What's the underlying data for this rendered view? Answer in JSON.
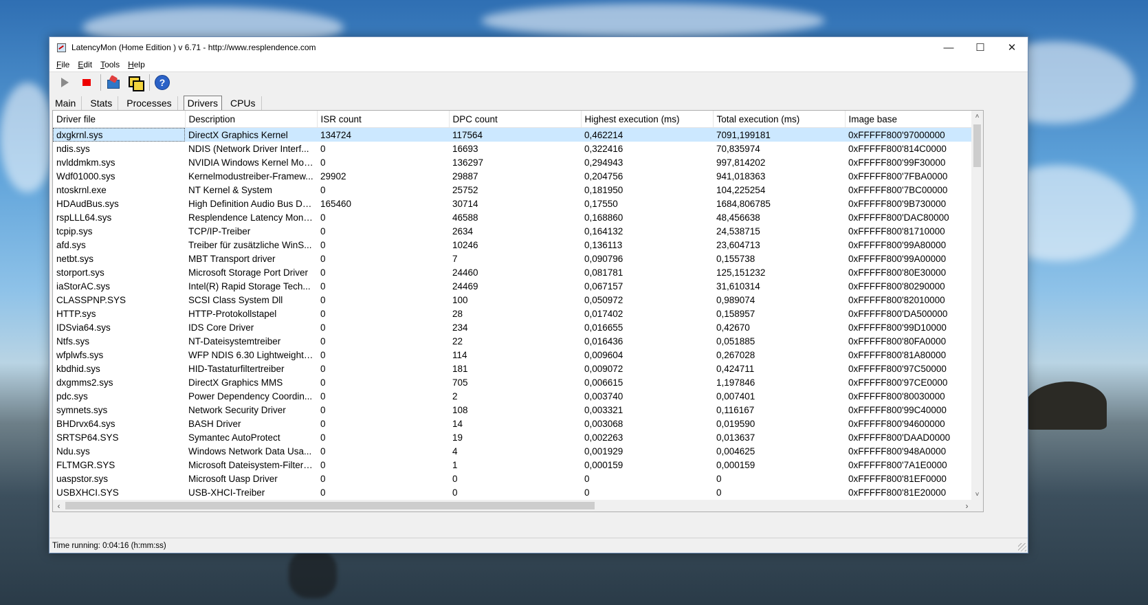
{
  "window": {
    "title": "LatencyMon  (Home Edition )  v 6.71 - http://www.resplendence.com",
    "minimize": "—",
    "maximize": "☐",
    "close": "✕"
  },
  "menu": [
    {
      "label": "File",
      "accel": "F",
      "rest": "ile"
    },
    {
      "label": "Edit",
      "accel": "E",
      "rest": "dit"
    },
    {
      "label": "Tools",
      "accel": "T",
      "rest": "ools"
    },
    {
      "label": "Help",
      "accel": "H",
      "rest": "elp"
    }
  ],
  "toolbar": {
    "icons": [
      "play-icon",
      "stop-icon",
      "monitor-icon",
      "copy-icon",
      "help-icon"
    ],
    "help_glyph": "?"
  },
  "tabs": [
    "Main",
    "Stats",
    "Processes",
    "Drivers",
    "CPUs"
  ],
  "active_tab": "Drivers",
  "table": {
    "columns": [
      "Driver file",
      "Description",
      "ISR count",
      "DPC count",
      "Highest execution (ms)",
      "Total execution (ms)",
      "Image base"
    ],
    "rows": [
      [
        "dxgkrnl.sys",
        "DirectX Graphics Kernel",
        "134724",
        "117564",
        "0,462214",
        "7091,199181",
        "0xFFFFF800'97000000"
      ],
      [
        "ndis.sys",
        "NDIS (Network Driver Interf...",
        "0",
        "16693",
        "0,322416",
        "70,835974",
        "0xFFFFF800'814C0000"
      ],
      [
        "nvlddmkm.sys",
        "NVIDIA Windows Kernel Mod...",
        "0",
        "136297",
        "0,294943",
        "997,814202",
        "0xFFFFF800'99F30000"
      ],
      [
        "Wdf01000.sys",
        "Kernelmodustreiber-Framew...",
        "29902",
        "29887",
        "0,204756",
        "941,018363",
        "0xFFFFF800'7FBA0000"
      ],
      [
        "ntoskrnl.exe",
        "NT Kernel & System",
        "0",
        "25752",
        "0,181950",
        "104,225254",
        "0xFFFFF800'7BC00000"
      ],
      [
        "HDAudBus.sys",
        "High Definition Audio Bus Dri...",
        "165460",
        "30714",
        "0,17550",
        "1684,806785",
        "0xFFFFF800'9B730000"
      ],
      [
        "rspLLL64.sys",
        "Resplendence Latency Monit...",
        "0",
        "46588",
        "0,168860",
        "48,456638",
        "0xFFFFF800'DAC80000"
      ],
      [
        "tcpip.sys",
        "TCP/IP-Treiber",
        "0",
        "2634",
        "0,164132",
        "24,538715",
        "0xFFFFF800'81710000"
      ],
      [
        "afd.sys",
        "Treiber für zusätzliche WinS...",
        "0",
        "10246",
        "0,136113",
        "23,604713",
        "0xFFFFF800'99A80000"
      ],
      [
        "netbt.sys",
        "MBT Transport driver",
        "0",
        "7",
        "0,090796",
        "0,155738",
        "0xFFFFF800'99A00000"
      ],
      [
        "storport.sys",
        "Microsoft Storage Port Driver",
        "0",
        "24460",
        "0,081781",
        "125,151232",
        "0xFFFFF800'80E30000"
      ],
      [
        "iaStorAC.sys",
        "Intel(R) Rapid Storage Tech...",
        "0",
        "24469",
        "0,067157",
        "31,610314",
        "0xFFFFF800'80290000"
      ],
      [
        "CLASSPNP.SYS",
        "SCSI Class System Dll",
        "0",
        "100",
        "0,050972",
        "0,989074",
        "0xFFFFF800'82010000"
      ],
      [
        "HTTP.sys",
        "HTTP-Protokollstapel",
        "0",
        "28",
        "0,017402",
        "0,158957",
        "0xFFFFF800'DA500000"
      ],
      [
        "IDSvia64.sys",
        "IDS Core Driver",
        "0",
        "234",
        "0,016655",
        "0,42670",
        "0xFFFFF800'99D10000"
      ],
      [
        "Ntfs.sys",
        "NT-Dateisystemtreiber",
        "0",
        "22",
        "0,016436",
        "0,051885",
        "0xFFFFF800'80FA0000"
      ],
      [
        "wfplwfs.sys",
        "WFP NDIS 6.30 Lightweight ...",
        "0",
        "114",
        "0,009604",
        "0,267028",
        "0xFFFFF800'81A80000"
      ],
      [
        "kbdhid.sys",
        "HID-Tastaturfiltertreiber",
        "0",
        "181",
        "0,009072",
        "0,424711",
        "0xFFFFF800'97C50000"
      ],
      [
        "dxgmms2.sys",
        "DirectX Graphics MMS",
        "0",
        "705",
        "0,006615",
        "1,197846",
        "0xFFFFF800'97CE0000"
      ],
      [
        "pdc.sys",
        "Power Dependency Coordin...",
        "0",
        "2",
        "0,003740",
        "0,007401",
        "0xFFFFF800'80030000"
      ],
      [
        "symnets.sys",
        "Network Security Driver",
        "0",
        "108",
        "0,003321",
        "0,116167",
        "0xFFFFF800'99C40000"
      ],
      [
        "BHDrvx64.sys",
        "BASH Driver",
        "0",
        "14",
        "0,003068",
        "0,019590",
        "0xFFFFF800'94600000"
      ],
      [
        "SRTSP64.SYS",
        "Symantec AutoProtect",
        "0",
        "19",
        "0,002263",
        "0,013637",
        "0xFFFFF800'DAAD0000"
      ],
      [
        "Ndu.sys",
        "Windows Network Data Usa...",
        "0",
        "4",
        "0,001929",
        "0,004625",
        "0xFFFFF800'948A0000"
      ],
      [
        "FLTMGR.SYS",
        "Microsoft Dateisystem-Filter-...",
        "0",
        "1",
        "0,000159",
        "0,000159",
        "0xFFFFF800'7A1E0000"
      ],
      [
        "uaspstor.sys",
        "Microsoft Uasp Driver",
        "0",
        "0",
        "0",
        "0",
        "0xFFFFF800'81EF0000"
      ],
      [
        "USBXHCI.SYS",
        "USB-XHCI-Treiber",
        "0",
        "0",
        "0",
        "0",
        "0xFFFFF800'81E20000"
      ]
    ]
  },
  "scroll": {
    "up": "˄",
    "down": "˅",
    "left": "‹",
    "right": "›"
  },
  "status": "Time running: 0:04:16  (h:mm:ss)"
}
